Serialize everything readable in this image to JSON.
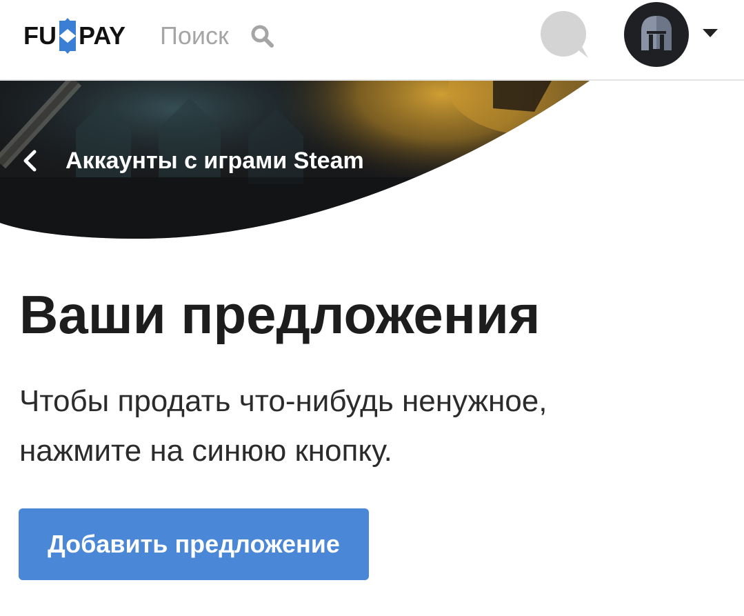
{
  "header": {
    "logo_left": "FU",
    "logo_right": "PAY",
    "search_label": "Поиск"
  },
  "breadcrumb": {
    "back_label": "Аккаунты с играми Steam"
  },
  "main": {
    "title": "Ваши предложения",
    "description_lines": [
      "Чтобы продать что-нибудь ненужное,",
      "нажмите на синюю кнопку."
    ],
    "add_button_label": "Добавить предложение"
  },
  "colors": {
    "accent": "#4a87d6",
    "logo_mark": "#3b7fd4",
    "text_dark": "#1d1d1d",
    "search_placeholder": "#a5a5a5",
    "chat_icon": "#d4d4d4",
    "avatar_bg": "#1f2023"
  },
  "icons": {
    "logo_mark": "funpay-arrow-mark",
    "search": "search-icon",
    "chat": "chat-bubble-icon",
    "avatar": "spartan-helmet-avatar",
    "dropdown": "caret-down-icon",
    "back": "chevron-left-icon"
  }
}
